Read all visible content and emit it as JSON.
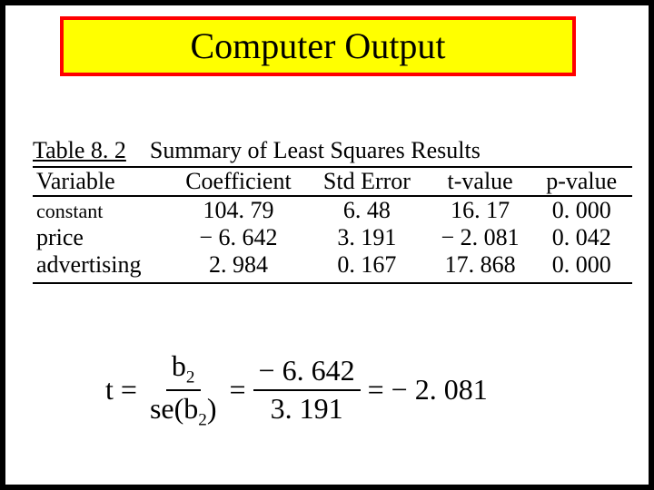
{
  "title": "Computer  Output",
  "table": {
    "caption_label": "Table 8. 2",
    "caption_text": "Summary of Least Squares Results",
    "headers": {
      "variable": "Variable",
      "coef": "Coefficient",
      "se": "Std Error",
      "t": "t-value",
      "p": "p-value"
    },
    "rows": [
      {
        "variable": "constant",
        "coef": "104. 79",
        "se": "6. 48",
        "t": "16. 17",
        "p": "0. 000"
      },
      {
        "variable": "price",
        "coef": "− 6. 642",
        "se": "3. 191",
        "t": "− 2. 081",
        "p": "0. 042"
      },
      {
        "variable": "advertising",
        "coef": "2. 984",
        "se": "0. 167",
        "t": "17. 868",
        "p": "0. 000"
      }
    ]
  },
  "formula": {
    "lhs": "t",
    "eq": "=",
    "frac1_num_var": "b",
    "frac1_num_sub": "2",
    "frac1_den_fn": "se(b",
    "frac1_den_sub": "2",
    "frac1_den_close": ")",
    "frac2_num": "− 6. 642",
    "frac2_den": "3. 191",
    "result": "− 2. 081"
  }
}
